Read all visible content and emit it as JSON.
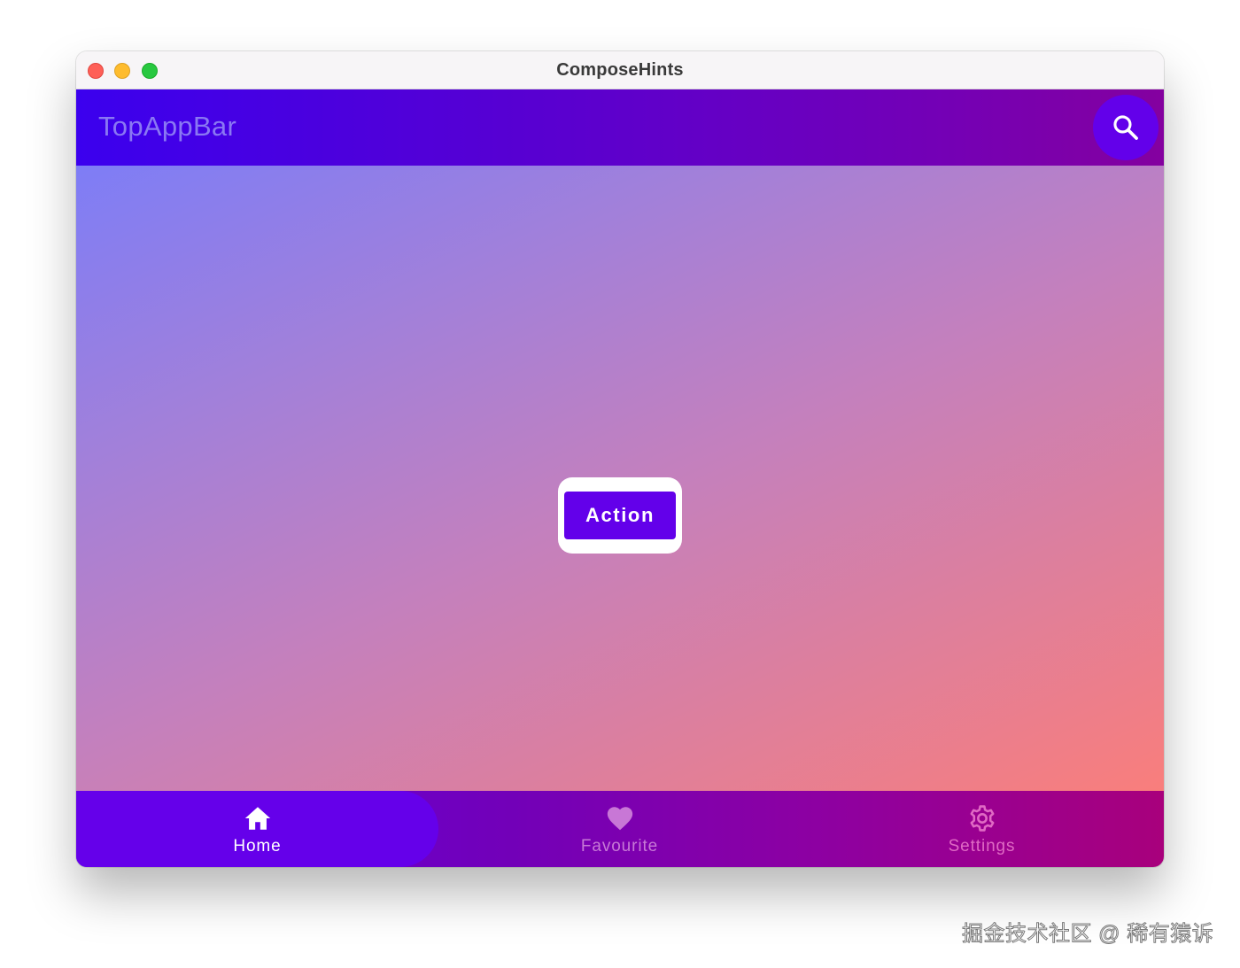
{
  "window": {
    "title": "ComposeHints"
  },
  "top_app_bar": {
    "title": "TopAppBar",
    "action_icon": "search-icon"
  },
  "content": {
    "action_button_label": "Action"
  },
  "bottom_nav": {
    "selected": "home",
    "items": [
      {
        "id": "home",
        "label": "Home",
        "icon": "home-icon"
      },
      {
        "id": "favourite",
        "label": "Favourite",
        "icon": "heart-icon"
      },
      {
        "id": "settings",
        "label": "Settings",
        "icon": "gear-icon"
      }
    ]
  },
  "watermark": {
    "text": "掘金技术社区 @ 稀有猿诉"
  },
  "colors": {
    "primary": "#6300ea",
    "top_bar_start": "#3b00ee",
    "top_bar_end": "#84009f",
    "content_gradient_start": "#7e7df6",
    "content_gradient_end": "#f97e7c",
    "bottom_bar_end": "#a8007c",
    "close_light": "#fe5f57",
    "minimize_light": "#febc2e",
    "maximize_light": "#28c840"
  }
}
